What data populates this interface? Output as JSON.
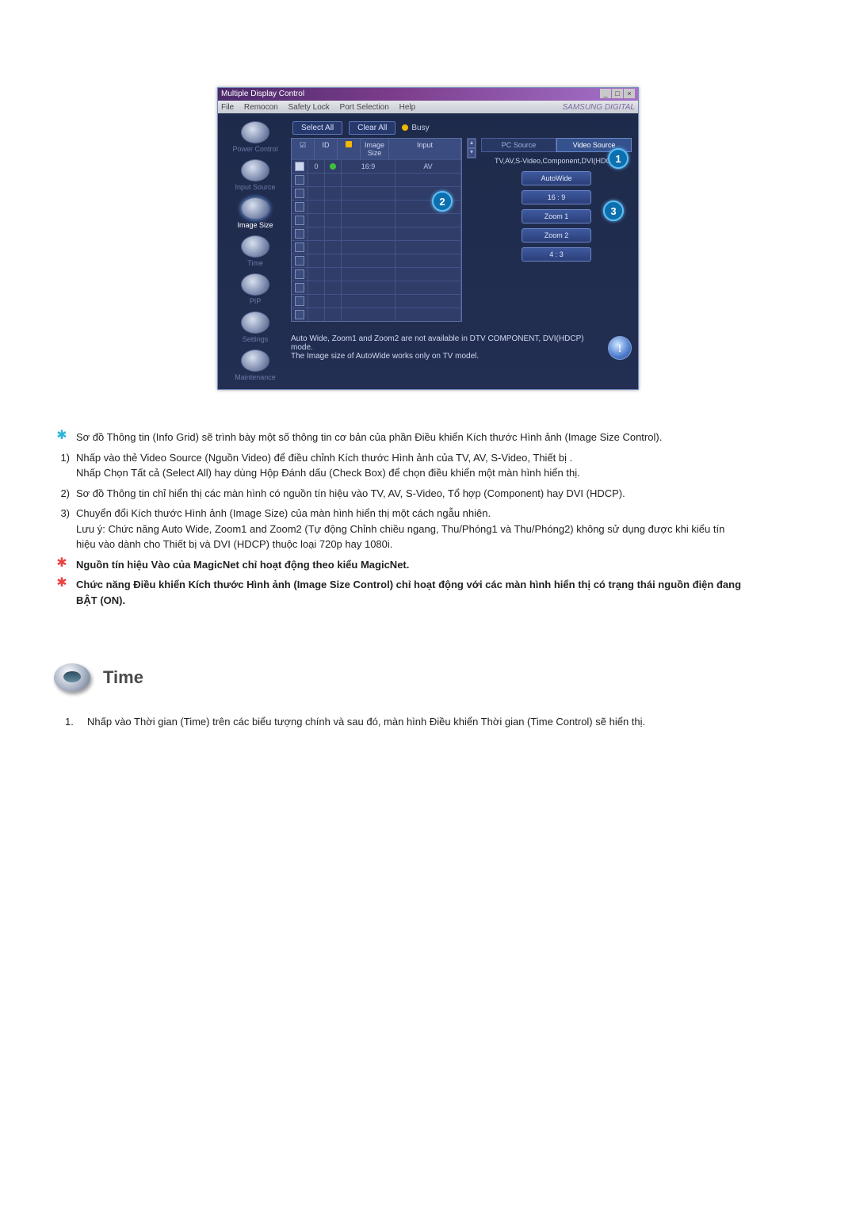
{
  "app": {
    "title": "Multiple Display Control",
    "menus": [
      "File",
      "Remocon",
      "Safety Lock",
      "Port Selection",
      "Help"
    ],
    "brand": "SAMSUNG DIGITAL",
    "toolbar": {
      "select_all": "Select All",
      "clear_all": "Clear All",
      "busy": "Busy"
    },
    "sidebar": [
      {
        "label": "Power Control",
        "active": false
      },
      {
        "label": "Input Source",
        "active": false
      },
      {
        "label": "Image Size",
        "active": true
      },
      {
        "label": "Time",
        "active": false
      },
      {
        "label": "PIP",
        "active": false
      },
      {
        "label": "Settings",
        "active": false
      },
      {
        "label": "Maintenance",
        "active": false
      }
    ],
    "grid": {
      "headers": {
        "cb": "☑",
        "id": "ID",
        "dot": "",
        "size": "Image Size",
        "input": "Input"
      },
      "rows": [
        {
          "checked": true,
          "id": "0",
          "dot": true,
          "size": "16:9",
          "input": "AV"
        },
        {
          "checked": false
        },
        {
          "checked": false
        },
        {
          "checked": false
        },
        {
          "checked": false
        },
        {
          "checked": false
        },
        {
          "checked": false
        },
        {
          "checked": false
        },
        {
          "checked": false
        },
        {
          "checked": false
        },
        {
          "checked": false
        },
        {
          "checked": false
        }
      ]
    },
    "tabs": {
      "pc": "PC Source",
      "video": "Video Source"
    },
    "source_label": "TV,AV,S-Video,Component,DVI(HDCP)",
    "options": [
      "AutoWide",
      "16 : 9",
      "Zoom 1",
      "Zoom 2",
      "4 : 3"
    ],
    "footer": {
      "line1": "Auto Wide, Zoom1 and Zoom2 are not available in DTV COMPONENT, DVI(HDCP) mode.",
      "line2": "The Image size of AutoWide works only on TV model."
    },
    "callouts": {
      "c1": "1",
      "c2": "2",
      "c3": "3"
    }
  },
  "doc": {
    "items": [
      {
        "marker": "star",
        "text": "Sơ đồ Thông tin (Info Grid) sẽ trình bày một số thông tin cơ bản của phần Điều khiển Kích thước Hình ảnh (Image Size Control)."
      },
      {
        "marker": "1)",
        "text": "Nhấp vào thẻ Video Source (Nguồn Video) để điều chỉnh Kích thước Hình ảnh của TV, AV, S-Video, Thiết bị .",
        "sub": "Nhấp Chọn Tất cả (Select All) hay dùng Hộp Đánh dấu (Check Box) để chọn điều khiển một màn hình hiển thị."
      },
      {
        "marker": "2)",
        "text": "Sơ đồ Thông tin chỉ hiển thị các màn hình có nguồn tín hiệu vào TV, AV, S-Video, Tổ hợp (Component) hay DVI (HDCP)."
      },
      {
        "marker": "3)",
        "text": "Chuyển đổi Kích thước Hình ảnh (Image Size) của màn hình hiển thị một cách ngẫu nhiên.",
        "sub": "Lưu ý: Chức năng Auto Wide, Zoom1 and Zoom2 (Tự động Chỉnh chiều ngang, Thu/Phóng1 và Thu/Phóng2) không sử dụng được khi kiểu tín hiệu vào dành cho Thiết bị và DVI (HDCP) thuộc loại 720p hay 1080i."
      },
      {
        "marker": "redstar",
        "bold": true,
        "text": "Nguồn tín hiệu Vào của MagicNet chỉ hoạt động theo kiểu MagicNet."
      },
      {
        "marker": "redstar",
        "bold": true,
        "text": "Chức năng Điều khiển Kích thước Hình ảnh (Image Size Control) chỉ hoạt động với các màn hình hiển thị có trạng thái nguồn điện đang BẬT (ON)."
      }
    ],
    "section_title": "Time",
    "numbered": [
      {
        "num": "1.",
        "text": "Nhấp vào Thời gian (Time) trên các biểu tượng chính và sau đó, màn hình Điều khiển Thời gian (Time Control) sẽ hiển thị."
      }
    ]
  }
}
